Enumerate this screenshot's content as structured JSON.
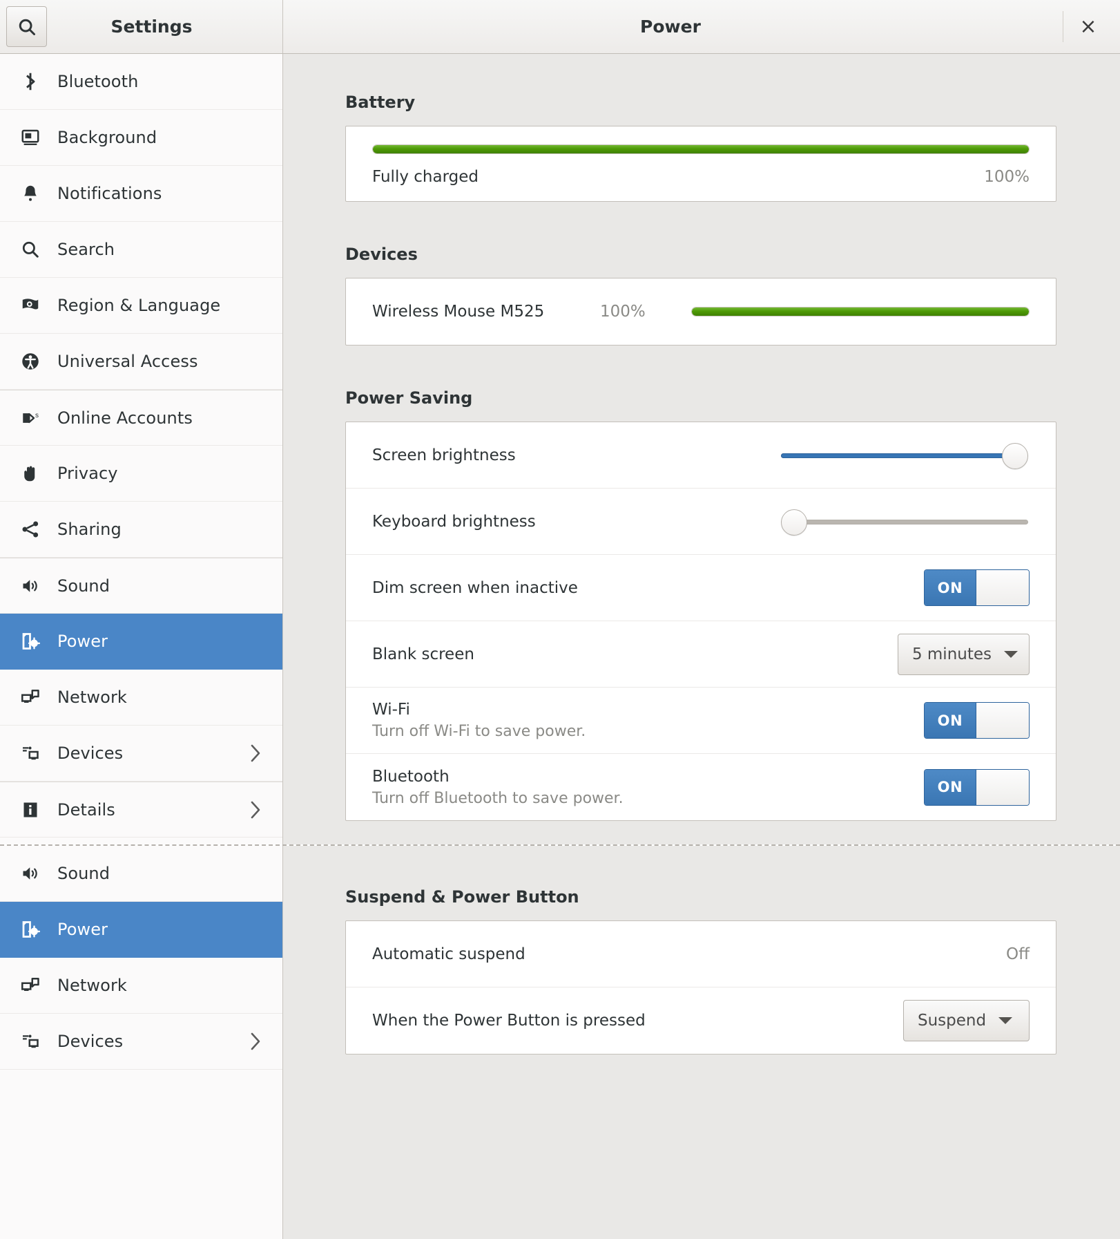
{
  "window": {
    "sidebar_title": "Settings",
    "panel_title": "Power",
    "close_label": "×"
  },
  "sidebar": {
    "items": [
      {
        "label": "Bluetooth",
        "icon": "bluetooth-icon",
        "chevron": false,
        "selected": false,
        "group_start": false
      },
      {
        "label": "Background",
        "icon": "background-icon",
        "chevron": false,
        "selected": false,
        "group_start": false
      },
      {
        "label": "Notifications",
        "icon": "notifications-icon",
        "chevron": false,
        "selected": false,
        "group_start": false
      },
      {
        "label": "Search",
        "icon": "search-icon",
        "chevron": false,
        "selected": false,
        "group_start": false
      },
      {
        "label": "Region & Language",
        "icon": "region-language-icon",
        "chevron": false,
        "selected": false,
        "group_start": false
      },
      {
        "label": "Universal Access",
        "icon": "universal-access-icon",
        "chevron": false,
        "selected": false,
        "group_start": false
      },
      {
        "label": "Online Accounts",
        "icon": "online-accounts-icon",
        "chevron": false,
        "selected": false,
        "group_start": true
      },
      {
        "label": "Privacy",
        "icon": "privacy-icon",
        "chevron": false,
        "selected": false,
        "group_start": false
      },
      {
        "label": "Sharing",
        "icon": "sharing-icon",
        "chevron": false,
        "selected": false,
        "group_start": false
      },
      {
        "label": "Sound",
        "icon": "sound-icon",
        "chevron": false,
        "selected": false,
        "group_start": true
      },
      {
        "label": "Power",
        "icon": "power-icon",
        "chevron": false,
        "selected": true,
        "group_start": false
      },
      {
        "label": "Network",
        "icon": "network-icon",
        "chevron": false,
        "selected": false,
        "group_start": false
      },
      {
        "label": "Devices",
        "icon": "devices-icon",
        "chevron": true,
        "selected": false,
        "group_start": false
      },
      {
        "label": "Details",
        "icon": "details-icon",
        "chevron": true,
        "selected": false,
        "group_start": true
      }
    ],
    "items_bottom": [
      {
        "label": "Sound",
        "icon": "sound-icon",
        "chevron": false,
        "selected": false,
        "group_start": false
      },
      {
        "label": "Power",
        "icon": "power-icon",
        "chevron": false,
        "selected": true,
        "group_start": false
      },
      {
        "label": "Network",
        "icon": "network-icon",
        "chevron": false,
        "selected": false,
        "group_start": false
      },
      {
        "label": "Devices",
        "icon": "devices-icon",
        "chevron": true,
        "selected": false,
        "group_start": false
      }
    ]
  },
  "battery": {
    "section_title": "Battery",
    "status": "Fully charged",
    "percent_label": "100%",
    "percent_value": 100,
    "bar_color": "#4e9a06"
  },
  "devices": {
    "section_title": "Devices",
    "items": [
      {
        "name": "Wireless Mouse M525",
        "percent_label": "100%",
        "percent_value": 100
      }
    ]
  },
  "power_saving": {
    "section_title": "Power Saving",
    "screen_brightness": {
      "label": "Screen brightness",
      "value": 100
    },
    "keyboard_brightness": {
      "label": "Keyboard brightness",
      "value": 0
    },
    "dim_screen": {
      "label": "Dim screen when inactive",
      "state": "ON"
    },
    "blank_screen": {
      "label": "Blank screen",
      "value": "5 minutes"
    },
    "wifi": {
      "label": "Wi-Fi",
      "sublabel": "Turn off Wi-Fi to save power.",
      "state": "ON"
    },
    "bluetooth": {
      "label": "Bluetooth",
      "sublabel": "Turn off Bluetooth to save power.",
      "state": "ON"
    }
  },
  "suspend": {
    "section_title": "Suspend & Power Button",
    "automatic_suspend": {
      "label": "Automatic suspend",
      "value": "Off"
    },
    "power_button": {
      "label": "When the Power Button is pressed",
      "value": "Suspend"
    }
  },
  "colors": {
    "accent": "#4a86c7",
    "battery_green": "#4e9a06",
    "slider_blue": "#3775b5",
    "content_bg": "#e9e8e6"
  }
}
